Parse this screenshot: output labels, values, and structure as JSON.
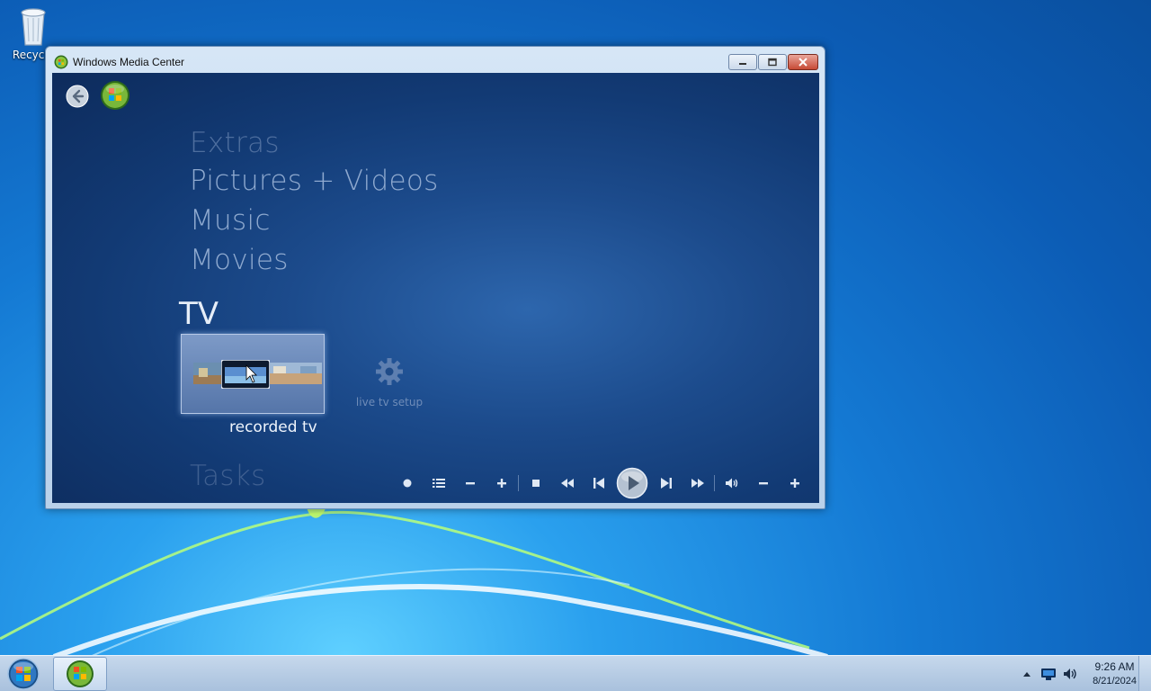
{
  "desktop": {
    "icons": [
      {
        "label": "Recycle",
        "icon": "recycle-bin-icon"
      }
    ]
  },
  "window": {
    "title": "Windows Media Center",
    "icon": "media-center-icon",
    "caption_buttons": [
      "minimize-icon",
      "restore-icon",
      "close-icon"
    ]
  },
  "media_center": {
    "nav": {
      "back_icon": "back-arrow-icon",
      "home_icon": "windows-orb-icon"
    },
    "menu": {
      "extras": "Extras",
      "pictures_videos": "Pictures + Videos",
      "music": "Music",
      "movies": "Movies",
      "tv": "TV",
      "tasks": "Tasks"
    },
    "tv_tiles": {
      "recorded_tv": "recorded tv",
      "live_tv_setup": "live tv setup"
    },
    "transport": [
      "record-icon",
      "guide-icon",
      "channel-down-icon",
      "channel-up-icon",
      "stop-icon",
      "rewind-icon",
      "skip-back-icon",
      "play-icon",
      "skip-forward-icon",
      "fast-forward-icon",
      "volume-icon",
      "volume-down-icon",
      "volume-up-icon"
    ]
  },
  "taskbar": {
    "start_icon": "windows-start-orb-icon",
    "pinned": [
      {
        "name": "Windows Media Center",
        "icon": "media-center-icon"
      }
    ],
    "tray_icons": [
      "show-hidden-icons-arrow",
      "network-icon",
      "volume-icon"
    ],
    "time": "9:26 AM",
    "date": "8/21/2024"
  },
  "colors": {
    "desktop_blue": "#1479d3",
    "mc_background": "#1c4b8c",
    "menu_text": "#8ea9cf",
    "focused_text": "#e6eef8",
    "taskbar": "#b9cde4"
  }
}
